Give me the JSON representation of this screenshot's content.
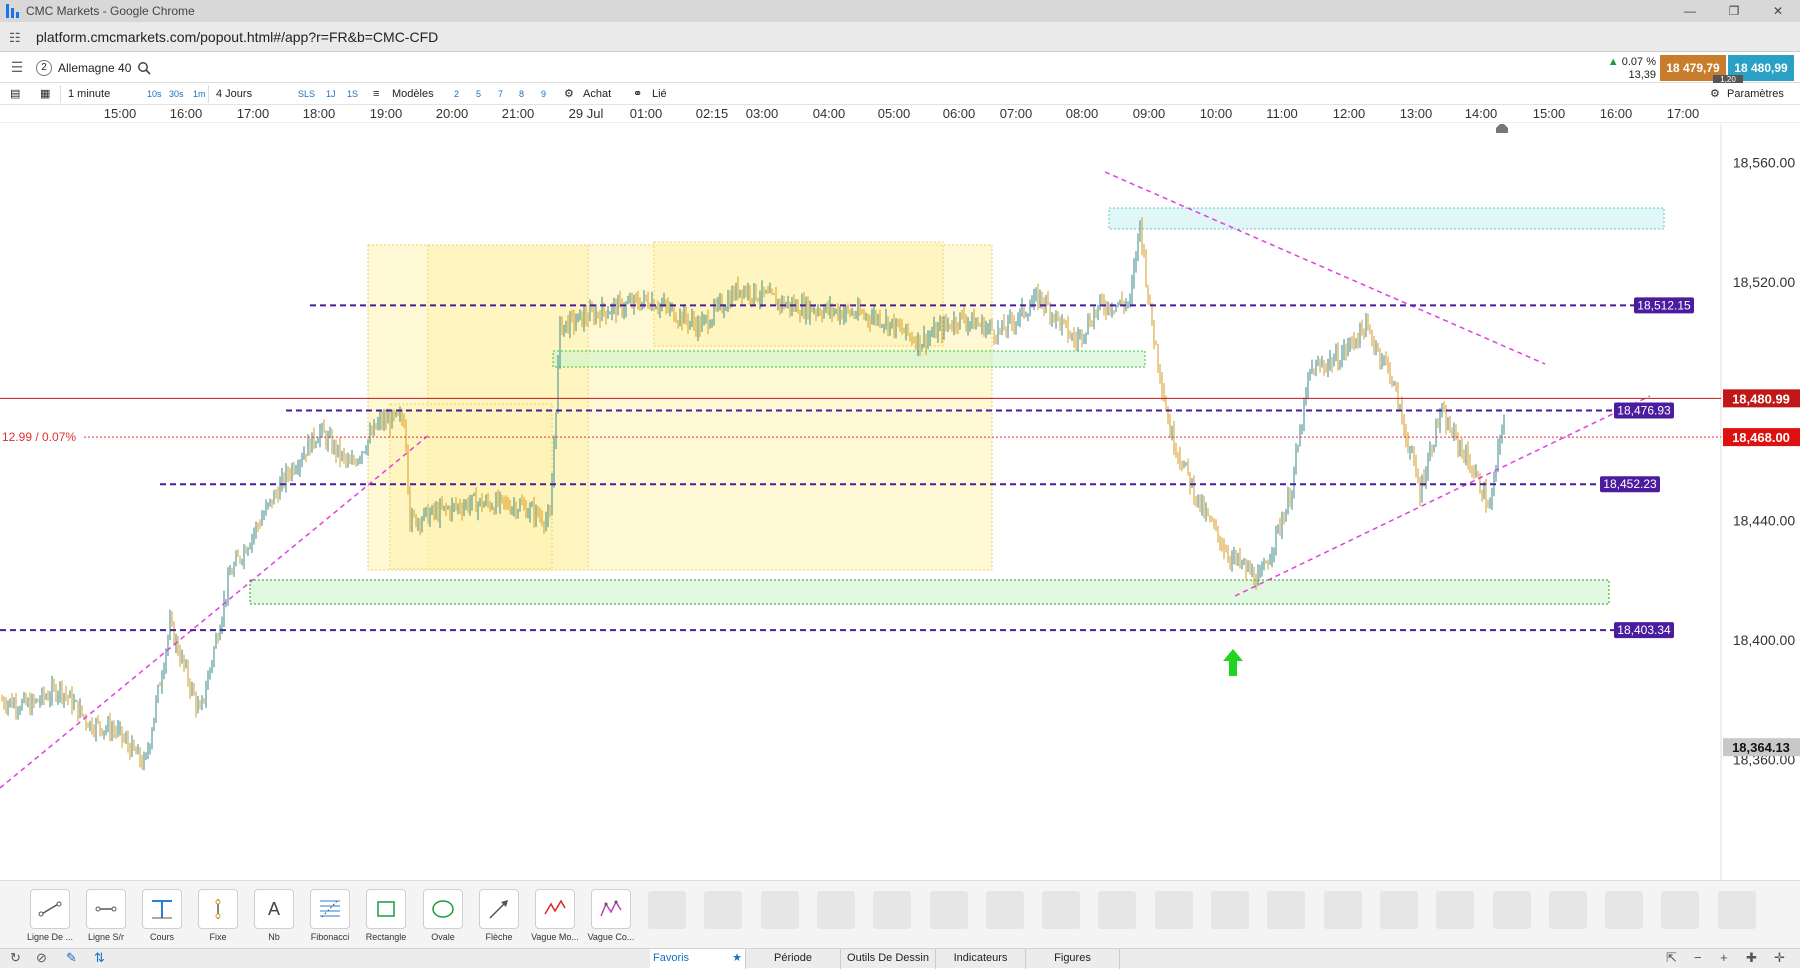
{
  "browser": {
    "window_title": "CMC Markets - Google Chrome",
    "url": "platform.cmcmarkets.com/popout.html#/app?r=FR&b=CMC-CFD"
  },
  "app": {
    "instrument_number": "2",
    "instrument_name": "Allemagne 40",
    "change_pct": "0.07 %",
    "change_pts": "13,39",
    "sell_price": "18 479,79",
    "buy_price": "18 480,99",
    "spread": "1,20"
  },
  "toolbar": {
    "interval": "1 minute",
    "interval_shortcuts": [
      "10s",
      "30s",
      "1m"
    ],
    "range": "4 Jours",
    "range_shortcuts": [
      "SLS",
      "1J",
      "1S"
    ],
    "templates_label": "Modèles",
    "template_numbers": [
      "2",
      "5",
      "7",
      "8",
      "9"
    ],
    "buy_label": "Achat",
    "link_label": "Lié",
    "settings_label": "Paramètres"
  },
  "time_axis": [
    "15:00",
    "16:00",
    "17:00",
    "18:00",
    "19:00",
    "20:00",
    "21:00",
    "29 Jul",
    "01:00",
    "02:15",
    "03:00",
    "04:00",
    "05:00",
    "06:00",
    "07:00",
    "08:00",
    "09:00",
    "10:00",
    "11:00",
    "12:00",
    "13:00",
    "14:00",
    "15:00",
    "16:00",
    "17:00"
  ],
  "price_axis": [
    "18,560.00",
    "18,520.00",
    "18,440.00",
    "18,400.00",
    "18,360.00"
  ],
  "colors": {
    "level_line": "#4b1d9e",
    "trend_line": "#e040e0",
    "current_price": "#c01818",
    "zone_yellow": "#fff3b0",
    "zone_green": "#c8f2c8",
    "zone_cyan": "#c9f0f0",
    "arrow": "#21d421",
    "candle_up": "#3a8a8a",
    "candle_down": "#d89a20"
  },
  "chart_data": {
    "type": "line",
    "symbol": "Allemagne 40",
    "ylim": [
      18340,
      18575
    ],
    "y_ticks": [
      18360,
      18400,
      18440,
      18520,
      18560
    ],
    "levels": [
      {
        "value": 18512.15,
        "label": "18,512.15"
      },
      {
        "value": 18476.93,
        "label": "18,476.93"
      },
      {
        "value": 18452.23,
        "label": "18,452.23"
      },
      {
        "value": 18403.34,
        "label": "18,403.34"
      }
    ],
    "current_price": {
      "value": 18480.99,
      "label": "18,480.99"
    },
    "reference_price": {
      "value": 18468.0,
      "label": "18,468.00",
      "change_label": "12.99 / 0.07%"
    },
    "crosshair_price": {
      "value": 18364.13,
      "label": "18,364.13"
    },
    "x": [
      "15:00",
      "16:00",
      "17:00",
      "18:00",
      "19:00",
      "20:00",
      "21:00",
      "29 Jul",
      "01:00",
      "02:15",
      "03:00",
      "04:00",
      "05:00",
      "06:00",
      "07:00",
      "08:00",
      "09:00",
      "10:00",
      "11:00",
      "12:00",
      "13:00",
      "14:00"
    ],
    "series": [
      {
        "values": [
          18380,
          18382,
          18372,
          18365,
          18400,
          18430,
          18455,
          18468,
          18448,
          18450,
          18447,
          18505,
          18512,
          18514,
          18508,
          18503,
          18504,
          18502,
          18512,
          18440,
          18425,
          18508,
          18470,
          18446,
          18480
        ]
      }
    ]
  },
  "drawing_tools": [
    {
      "label": "Ligne De ...",
      "icon": "trendline-icon"
    },
    {
      "label": "Ligne S/r",
      "icon": "horizontal-line-icon"
    },
    {
      "label": "Cours",
      "icon": "price-line-icon"
    },
    {
      "label": "Fixe",
      "icon": "vertical-line-icon"
    },
    {
      "label": "Nb",
      "icon": "text-icon"
    },
    {
      "label": "Fibonacci",
      "icon": "fibonacci-icon"
    },
    {
      "label": "Rectangle",
      "icon": "rectangle-icon"
    },
    {
      "label": "Ovale",
      "icon": "oval-icon"
    },
    {
      "label": "Flèche",
      "icon": "arrow-icon"
    },
    {
      "label": "Vague Mo...",
      "icon": "wave-icon"
    },
    {
      "label": "Vague Co...",
      "icon": "wave-corrective-icon"
    }
  ],
  "bottom_tabs": {
    "favorites": "Favoris",
    "period": "Période",
    "drawing_tools": "Outils De Dessin",
    "indicators": "Indicateurs",
    "figures": "Figures"
  },
  "text_tool_glyph": "A"
}
